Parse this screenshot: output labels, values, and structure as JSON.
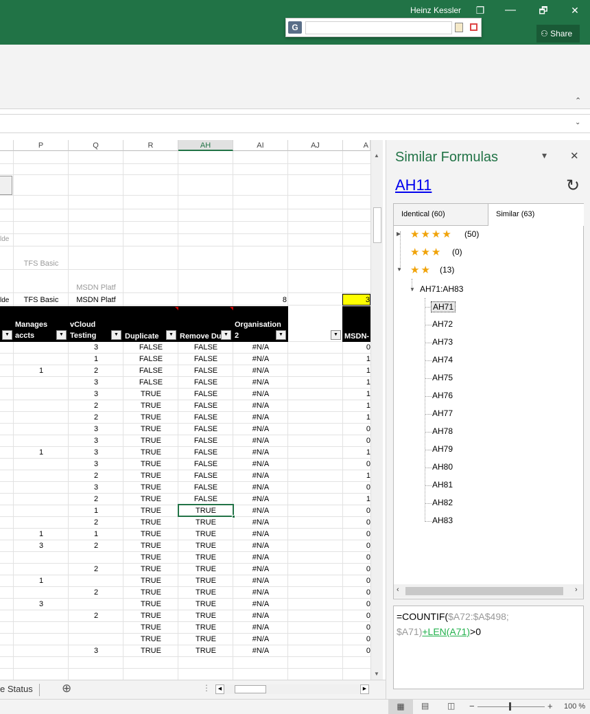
{
  "titlebar": {
    "user": "Heinz Kessler",
    "share": "Share",
    "restore_glyph": "❐",
    "maximize_glyph": "🗗",
    "close_glyph": "✕",
    "person_glyph": "⚇",
    "ribbon_collapse_glyph": "⌃",
    "fbar_drop_glyph": "⌄"
  },
  "floatbar": {
    "logo": "G"
  },
  "grid": {
    "columns": [
      "P",
      "Q",
      "R",
      "AH",
      "AI",
      "AJ",
      "A"
    ],
    "selected_column": "AH",
    "upper": {
      "c0_r5": "lde",
      "c1_r6": "TFS Basic",
      "c2_r7": "MSDN Platf",
      "c0_r8": "lde",
      "c1_r8": "TFS Basic",
      "c2_r8": "MSDN Platf",
      "ai_r8": "8",
      "last_r8": "3"
    },
    "headers": {
      "manages": "Manages accts",
      "vcloud": "vCloud Testing",
      "duplicate": "Duplicate",
      "remove": "Remove Du",
      "org": "Organisation 2",
      "msdn": "MSDN-"
    },
    "rows": [
      [
        "",
        "3",
        "FALSE",
        "FALSE",
        "#N/A"
      ],
      [
        "",
        "1",
        "FALSE",
        "FALSE",
        "#N/A"
      ],
      [
        "1",
        "2",
        "FALSE",
        "FALSE",
        "#N/A"
      ],
      [
        "",
        "3",
        "FALSE",
        "FALSE",
        "#N/A"
      ],
      [
        "",
        "3",
        "TRUE",
        "FALSE",
        "#N/A"
      ],
      [
        "",
        "2",
        "TRUE",
        "FALSE",
        "#N/A"
      ],
      [
        "",
        "2",
        "TRUE",
        "FALSE",
        "#N/A"
      ],
      [
        "",
        "3",
        "TRUE",
        "FALSE",
        "#N/A"
      ],
      [
        "",
        "3",
        "TRUE",
        "FALSE",
        "#N/A"
      ],
      [
        "1",
        "3",
        "TRUE",
        "FALSE",
        "#N/A"
      ],
      [
        "",
        "3",
        "TRUE",
        "FALSE",
        "#N/A"
      ],
      [
        "",
        "2",
        "TRUE",
        "FALSE",
        "#N/A"
      ],
      [
        "",
        "3",
        "TRUE",
        "FALSE",
        "#N/A"
      ],
      [
        "",
        "2",
        "TRUE",
        "FALSE",
        "#N/A"
      ],
      [
        "",
        "1",
        "TRUE",
        "TRUE",
        "#N/A"
      ],
      [
        "",
        "2",
        "TRUE",
        "TRUE",
        "#N/A"
      ],
      [
        "1",
        "1",
        "TRUE",
        "TRUE",
        "#N/A"
      ],
      [
        "3",
        "2",
        "TRUE",
        "TRUE",
        "#N/A"
      ],
      [
        "",
        "",
        "TRUE",
        "TRUE",
        "#N/A"
      ],
      [
        "",
        "2",
        "TRUE",
        "TRUE",
        "#N/A"
      ],
      [
        "1",
        "",
        "TRUE",
        "TRUE",
        "#N/A"
      ],
      [
        "",
        "2",
        "TRUE",
        "TRUE",
        "#N/A"
      ],
      [
        "3",
        "",
        "TRUE",
        "TRUE",
        "#N/A"
      ],
      [
        "",
        "2",
        "TRUE",
        "TRUE",
        "#N/A"
      ],
      [
        "",
        "",
        "TRUE",
        "TRUE",
        "#N/A"
      ],
      [
        "",
        "",
        "TRUE",
        "TRUE",
        "#N/A"
      ],
      [
        "",
        "3",
        "TRUE",
        "TRUE",
        "#N/A"
      ]
    ],
    "last_col": [
      "0",
      "1",
      "1",
      "1",
      "1",
      "1",
      "1",
      "0",
      "0",
      "1",
      "0",
      "1",
      "0",
      "1",
      "0",
      "0",
      "0",
      "0",
      "0",
      "0",
      "0",
      "0",
      "0",
      "0",
      "0",
      "0",
      "0"
    ]
  },
  "sheetbar": {
    "tab_label": "e Status",
    "add_glyph": "⊕"
  },
  "status": {
    "zoom": "100 %"
  },
  "pane": {
    "title": "Similar Formulas",
    "link": "AH11",
    "refresh_glyph": "↻",
    "menu_glyph": "▾",
    "close_glyph": "✕",
    "tabs": [
      {
        "label": "Identical",
        "count": "(60)"
      },
      {
        "label": "Similar",
        "count": "(63)"
      }
    ],
    "groups": [
      {
        "stars": "★★★★",
        "count": "(50)"
      },
      {
        "stars": "★★★",
        "count": "(0)"
      },
      {
        "stars": "★★",
        "count": "(13)"
      }
    ],
    "range": "AH71:AH83",
    "cells": [
      "AH71",
      "AH72",
      "AH73",
      "AH74",
      "AH75",
      "AH76",
      "AH77",
      "AH78",
      "AH79",
      "AH80",
      "AH81",
      "AH82",
      "AH83"
    ],
    "formula": {
      "p1": "=COUNTIF(",
      "p2": "$A72:$A$498;",
      "p3": "$A71)",
      "p4": "+LEN(A71)",
      ">": ">0"
    }
  },
  "colors": {
    "excel_green": "#217346",
    "yellow": "#ffff00",
    "star": "#f0a30a",
    "link": "#0000ee"
  }
}
